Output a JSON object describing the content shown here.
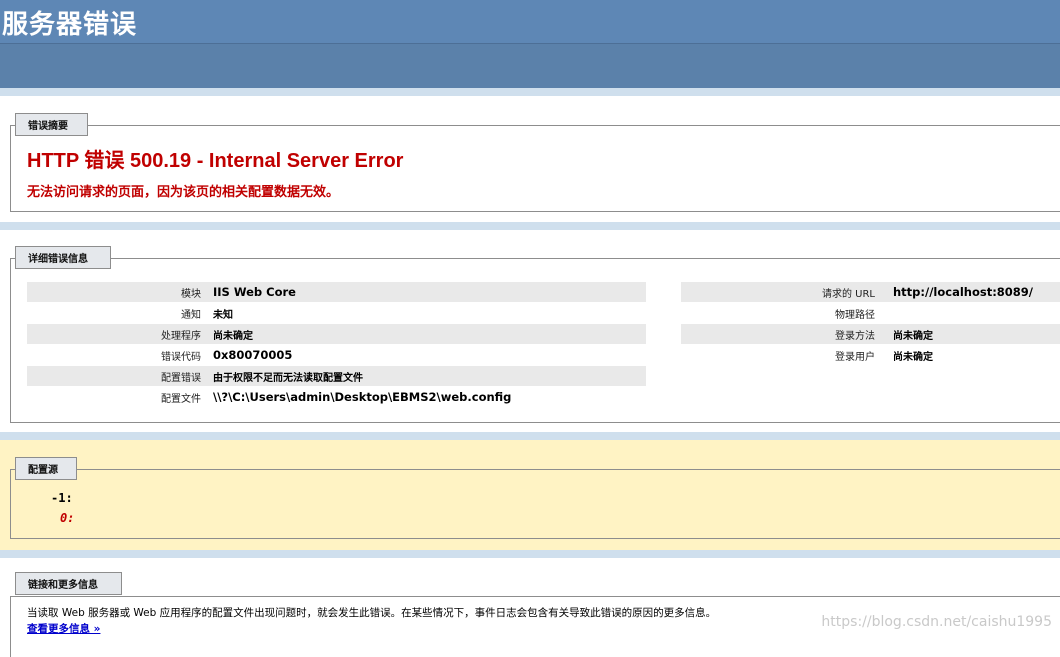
{
  "header": {
    "title": "服务器错误"
  },
  "summary": {
    "legend": "错误摘要",
    "title": "HTTP 错误 500.19 - Internal Server Error",
    "subtitle": "无法访问请求的页面，因为该页的相关配置数据无效。"
  },
  "details": {
    "legend": "详细错误信息",
    "left": [
      {
        "label": "模块",
        "value": "IIS Web Core"
      },
      {
        "label": "通知",
        "value": "未知"
      },
      {
        "label": "处理程序",
        "value": "尚未确定"
      },
      {
        "label": "错误代码",
        "value": "0x80070005"
      },
      {
        "label": "配置错误",
        "value": "由于权限不足而无法读取配置文件"
      },
      {
        "label": "配置文件",
        "value": "\\\\?\\C:\\Users\\admin\\Desktop\\EBMS2\\web.config"
      }
    ],
    "right": [
      {
        "label": "请求的 URL",
        "value": "http://localhost:8089/"
      },
      {
        "label": "物理路径",
        "value": ""
      },
      {
        "label": "登录方法",
        "value": "尚未确定"
      },
      {
        "label": "登录用户",
        "value": "尚未确定"
      }
    ]
  },
  "config_source": {
    "legend": "配置源",
    "lines": [
      {
        "text": "-1:",
        "color": "#000000"
      },
      {
        "text": "0:",
        "color": "#c00000"
      }
    ]
  },
  "links": {
    "legend": "链接和更多信息",
    "text": "当读取 Web 服务器或 Web 应用程序的配置文件出现问题时，就会发生此错误。在某些情况下，事件日志会包含有关导致此错误的原因的更多信息。",
    "more_link": "查看更多信息 »"
  },
  "watermark": "https://blog.csdn.net/caishu1995"
}
